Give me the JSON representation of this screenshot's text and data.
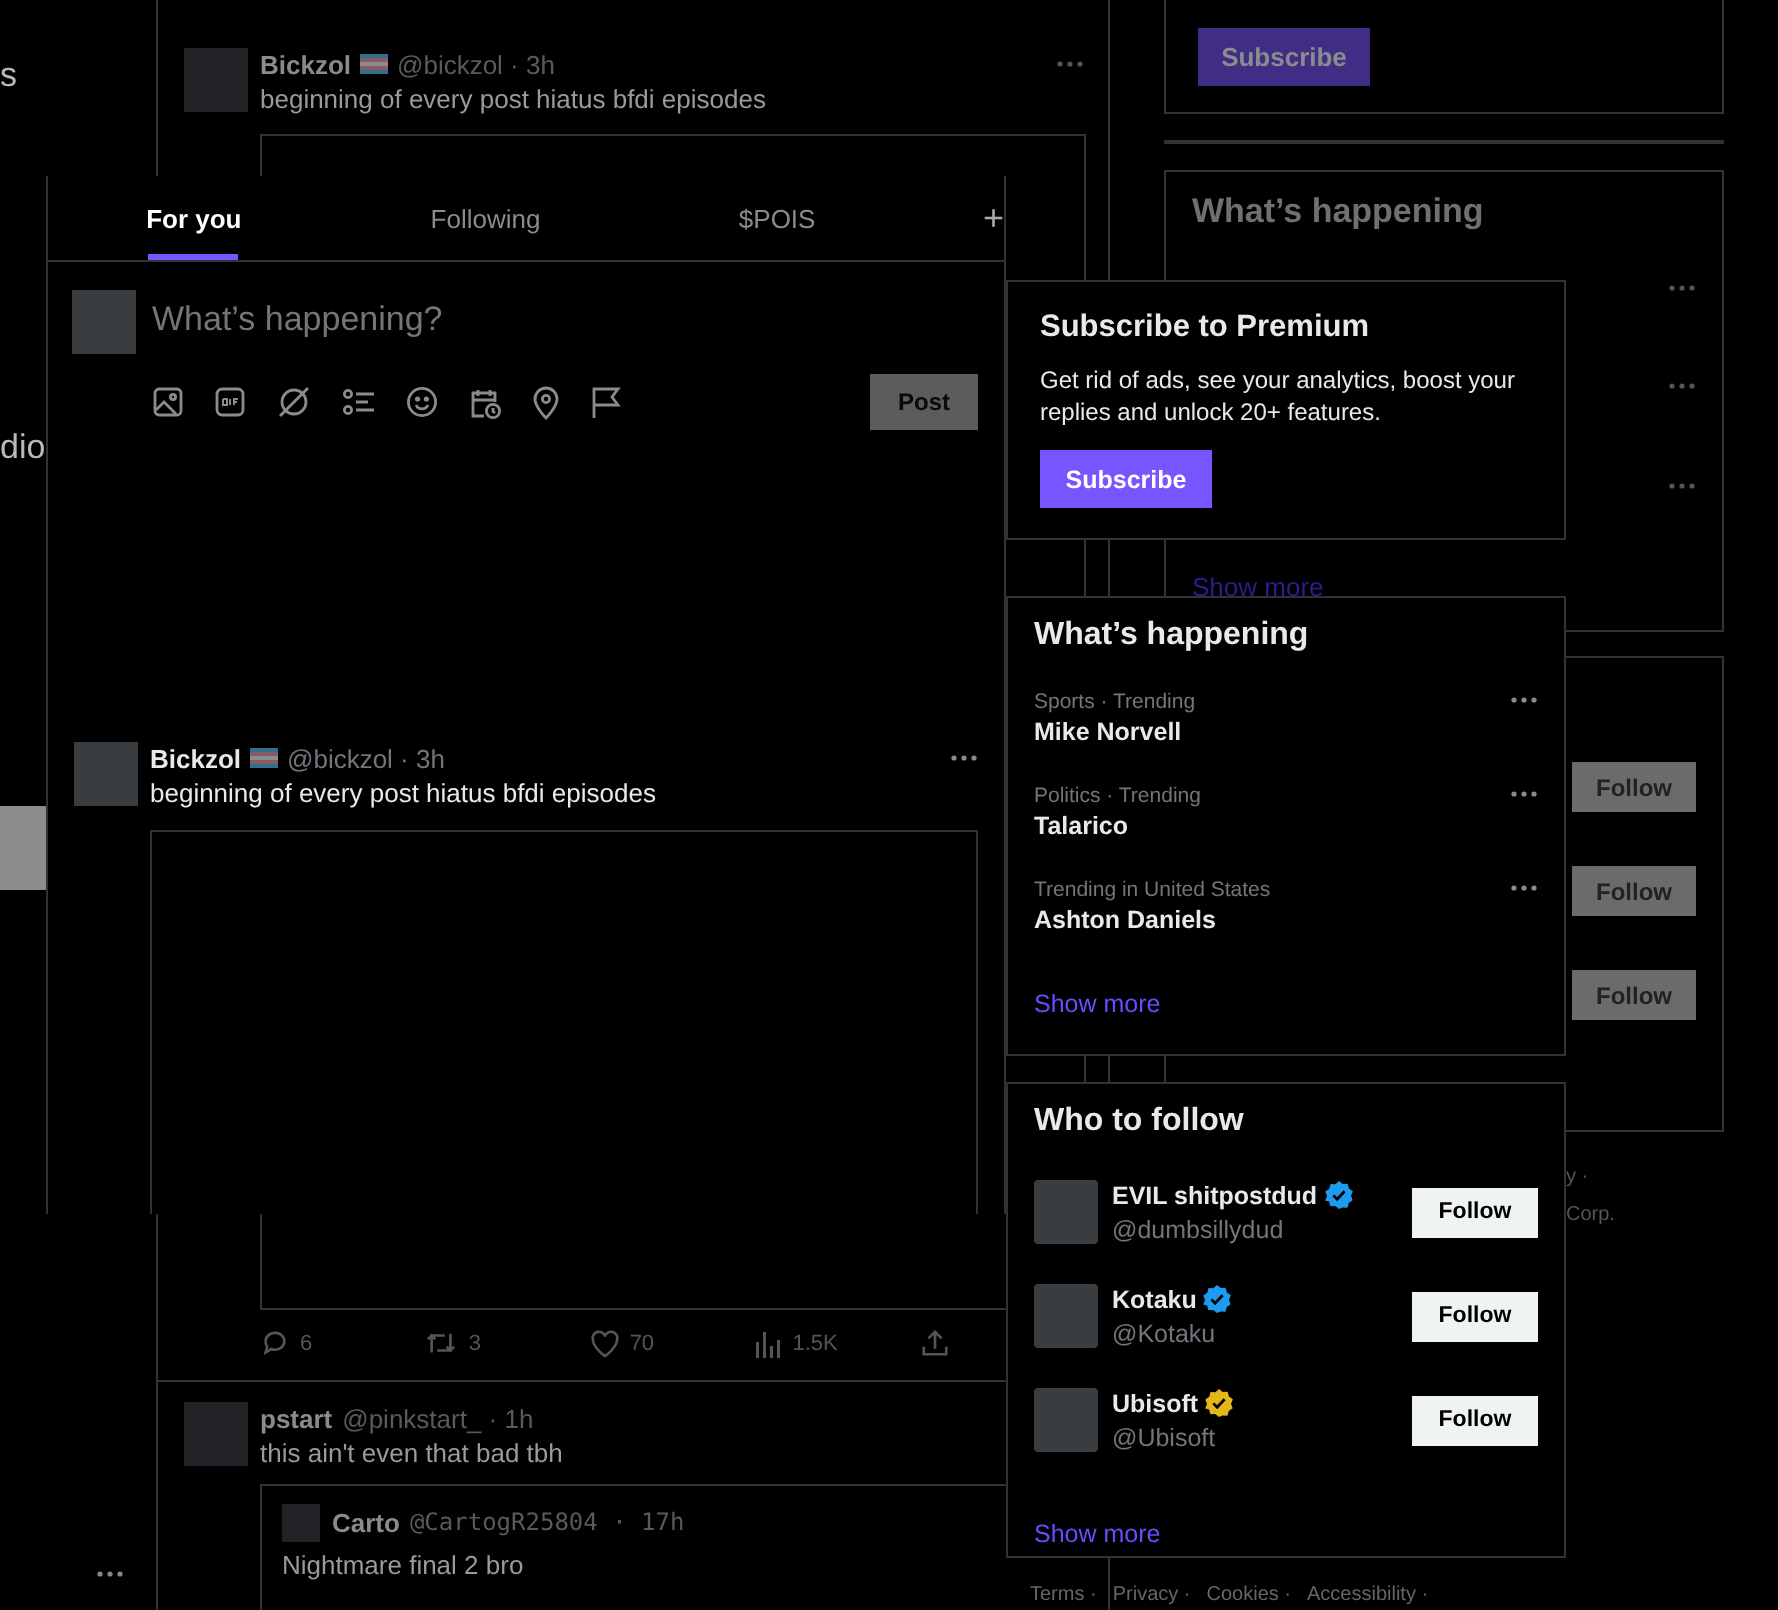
{
  "background": {
    "nav": {
      "fragments": [
        "s",
        "dio"
      ]
    },
    "post": {
      "author": "Bickzol",
      "handle": "@bickzol",
      "time": "· 3h",
      "text": "beginning of every post hiatus bfdi episodes",
      "stats": [
        {
          "kind": "reply",
          "count": "6"
        },
        {
          "kind": "repost",
          "count": "3"
        },
        {
          "kind": "like",
          "count": "70"
        },
        {
          "kind": "views",
          "count": "1.5K"
        },
        {
          "kind": "share"
        }
      ]
    },
    "reply": {
      "author": "pstart",
      "handle": "@pinkstart_",
      "time": "· 1h",
      "text": "this ain't even that bad tbh"
    },
    "quote": {
      "author": "Carto",
      "handle": "@CartogR25804",
      "time": "· 17h",
      "text": "Nightmare final 2 bro"
    },
    "subscribe_button": "Subscribe",
    "trends_title": "What’s happening",
    "show_more": "Show more",
    "follow_buttons": [
      "Follow",
      "Follow",
      "Follow"
    ],
    "footer_fragments": [
      "y ·",
      "Corp."
    ],
    "footer_links": [
      "Terms ·",
      "Privacy ·",
      "Cookies ·",
      "Accessibility ·"
    ]
  },
  "tabs": [
    {
      "label": "For you",
      "selected": true
    },
    {
      "label": "Following",
      "selected": false
    },
    {
      "label": "$POIS",
      "selected": false
    }
  ],
  "add_tab": "+",
  "composer": {
    "placeholder": "What’s happening?",
    "post_button": "Post",
    "post_disabled": true
  },
  "post": {
    "author": "Bickzol",
    "handle": "@bickzol",
    "time": "· 3h",
    "text": "beginning of every post hiatus bfdi episodes"
  },
  "premium": {
    "title": "Subscribe to Premium",
    "text": "Get rid of ads, see your analytics, boost your replies and unlock 20+ features.",
    "button": "Subscribe"
  },
  "trends": {
    "title": "What’s happening",
    "items": [
      {
        "context": "Sports · Trending",
        "name": "Mike Norvell"
      },
      {
        "context": "Politics · Trending",
        "name": "Talarico"
      },
      {
        "context": "Trending in United States",
        "name": "Ashton Daniels"
      }
    ],
    "show_more": "Show more"
  },
  "who_to_follow": {
    "title": "Who to follow",
    "accounts": [
      {
        "name": "EVIL shitpostdud",
        "handle": "@dumbsillydud",
        "color": "#1d9bf0",
        "button": "Follow"
      },
      {
        "name": "Kotaku",
        "handle": "@Kotaku",
        "color": "#1d9bf0",
        "button": "Follow"
      },
      {
        "name": "Ubisoft",
        "handle": "@Ubisoft",
        "color": "#e2b719",
        "button": "Follow"
      }
    ],
    "show_more": "Show more"
  }
}
